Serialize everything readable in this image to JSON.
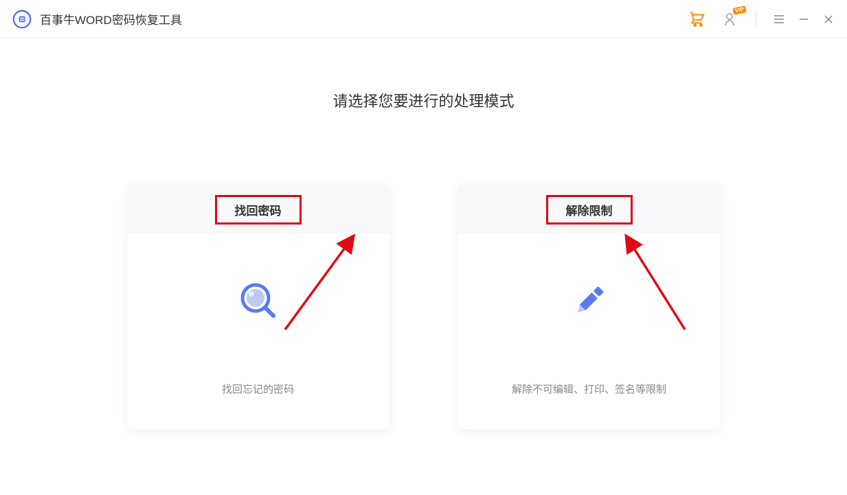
{
  "header": {
    "app_title": "百事牛WORD密码恢复工具",
    "vip_label": "VIP"
  },
  "main": {
    "heading": "请选择您要进行的处理模式",
    "cards": [
      {
        "title": "找回密码",
        "description": "找回忘记的密码"
      },
      {
        "title": "解除限制",
        "description": "解除不可编辑、打印、签名等限制"
      }
    ]
  },
  "colors": {
    "accent_orange": "#ff8a00",
    "accent_blue": "#5b7cf0",
    "annotation_red": "#e30613",
    "text_primary": "#333333",
    "text_secondary": "#888888"
  }
}
